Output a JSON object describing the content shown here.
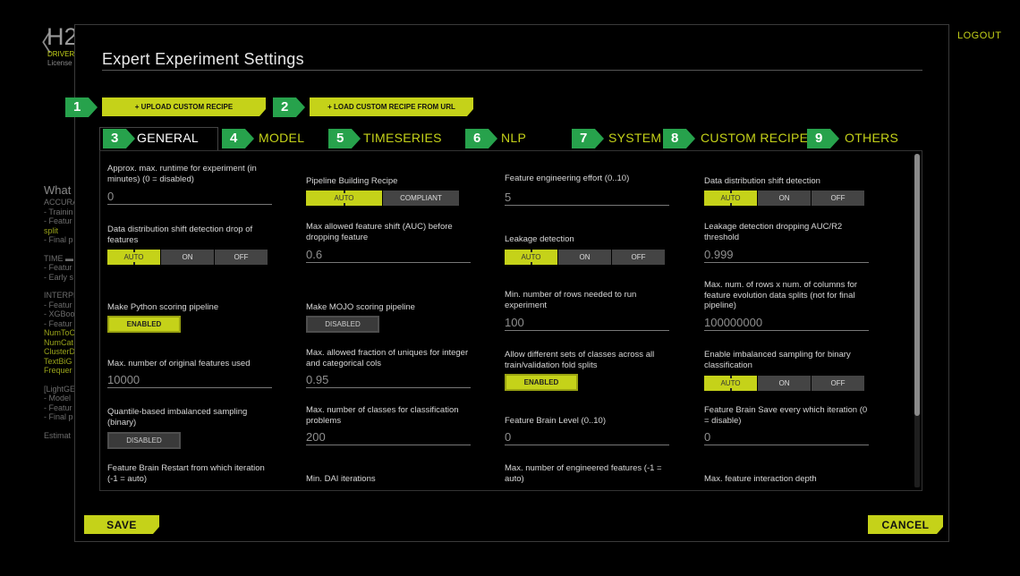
{
  "background": {
    "back": "〈",
    "title": "H2",
    "sub1": "DRIVER",
    "sub2": "License",
    "logout": "LOGOUT",
    "side": {
      "what": "What",
      "l1": "ACCURA",
      "l2": "- Trainin",
      "l3": "- Featur",
      "l4": "split",
      "l5": "- Final p",
      "l6": "TIME ▬",
      "l7": "- Featur",
      "l8": "- Early s",
      "l9": "INTERPR",
      "l10": "- Featur",
      "l11": "- XGBoo",
      "l12": "- Featur",
      "l13": "NumToC",
      "l14": "NumCat",
      "l15": "ClusterD",
      "l16": "TextBiG",
      "l17": "Frequer",
      "l18": "[LightGE",
      "l19": "- Model",
      "l20": "- Featur",
      "l21": "- Final p",
      "l22": "Estimat"
    }
  },
  "modal": {
    "title": "Expert Experiment Settings",
    "upload_label": "+ UPLOAD CUSTOM RECIPE",
    "url_label": "+ LOAD CUSTOM RECIPE FROM URL",
    "badges": [
      "1",
      "2",
      "3",
      "4",
      "5",
      "6",
      "7",
      "8",
      "9"
    ],
    "tabs": [
      "GENERAL",
      "MODEL",
      "TIMESERIES",
      "NLP",
      "SYSTEM",
      "CUSTOM RECIPES",
      "OTHERS"
    ],
    "save_label": "SAVE",
    "cancel_label": "CANCEL"
  },
  "settings": {
    "runtime": {
      "label": "Approx. max. runtime for experiment (in minutes) (0 = disabled)",
      "value": "0"
    },
    "pipeline": {
      "label": "Pipeline Building Recipe",
      "options": [
        "AUTO",
        "COMPLIANT"
      ]
    },
    "fe_effort": {
      "label": "Feature engineering effort (0..10)",
      "value": "5"
    },
    "dds": {
      "label": "Data distribution shift detection",
      "options": [
        "AUTO",
        "ON",
        "OFF"
      ]
    },
    "dds_drop": {
      "label": "Data distribution shift detection drop of features",
      "options": [
        "AUTO",
        "ON",
        "OFF"
      ]
    },
    "max_shift": {
      "label": "Max allowed feature shift (AUC) before dropping feature",
      "value": "0.6"
    },
    "leak": {
      "label": "Leakage detection",
      "options": [
        "AUTO",
        "ON",
        "OFF"
      ]
    },
    "leak_drop": {
      "label": "Leakage detection dropping AUC/R2 threshold",
      "value": "0.999"
    },
    "python_pipe": {
      "label": "Make Python scoring pipeline",
      "state": "ENABLED"
    },
    "mojo_pipe": {
      "label": "Make MOJO scoring pipeline",
      "state": "DISABLED"
    },
    "min_rows": {
      "label": "Min. number of rows needed to run experiment",
      "value": "100"
    },
    "max_rows_cols": {
      "label": "Max. num. of rows x num. of columns for feature evolution data splits (not for final pipeline)",
      "value": "100000000"
    },
    "max_orig": {
      "label": "Max. number of original features used",
      "value": "10000"
    },
    "frac_uniq": {
      "label": "Max. allowed fraction of uniques for integer and categorical cols",
      "value": "0.95"
    },
    "diff_classes": {
      "label": "Allow different sets of classes across all train/validation fold splits",
      "state": "ENABLED"
    },
    "imbalanced": {
      "label": "Enable imbalanced sampling for binary classification",
      "options": [
        "AUTO",
        "ON",
        "OFF"
      ]
    },
    "quantile": {
      "label": "Quantile-based imbalanced sampling (binary)",
      "state": "DISABLED"
    },
    "max_classes": {
      "label": "Max. number of classes for classification problems",
      "value": "200"
    },
    "brain_level": {
      "label": "Feature Brain Level (0..10)",
      "value": "0"
    },
    "brain_save": {
      "label": "Feature Brain Save every which iteration (0 = disable)",
      "value": "0"
    },
    "brain_restart": {
      "label": "Feature Brain Restart from which iteration (-1 = auto)"
    },
    "min_dai": {
      "label": "Min. DAI iterations"
    },
    "max_eng": {
      "label": "Max. number of engineered features (-1 = auto)"
    },
    "max_inter": {
      "label": "Max. feature interaction depth"
    }
  },
  "colors": {
    "accent": "#c5d219",
    "badge": "#27a24c"
  }
}
